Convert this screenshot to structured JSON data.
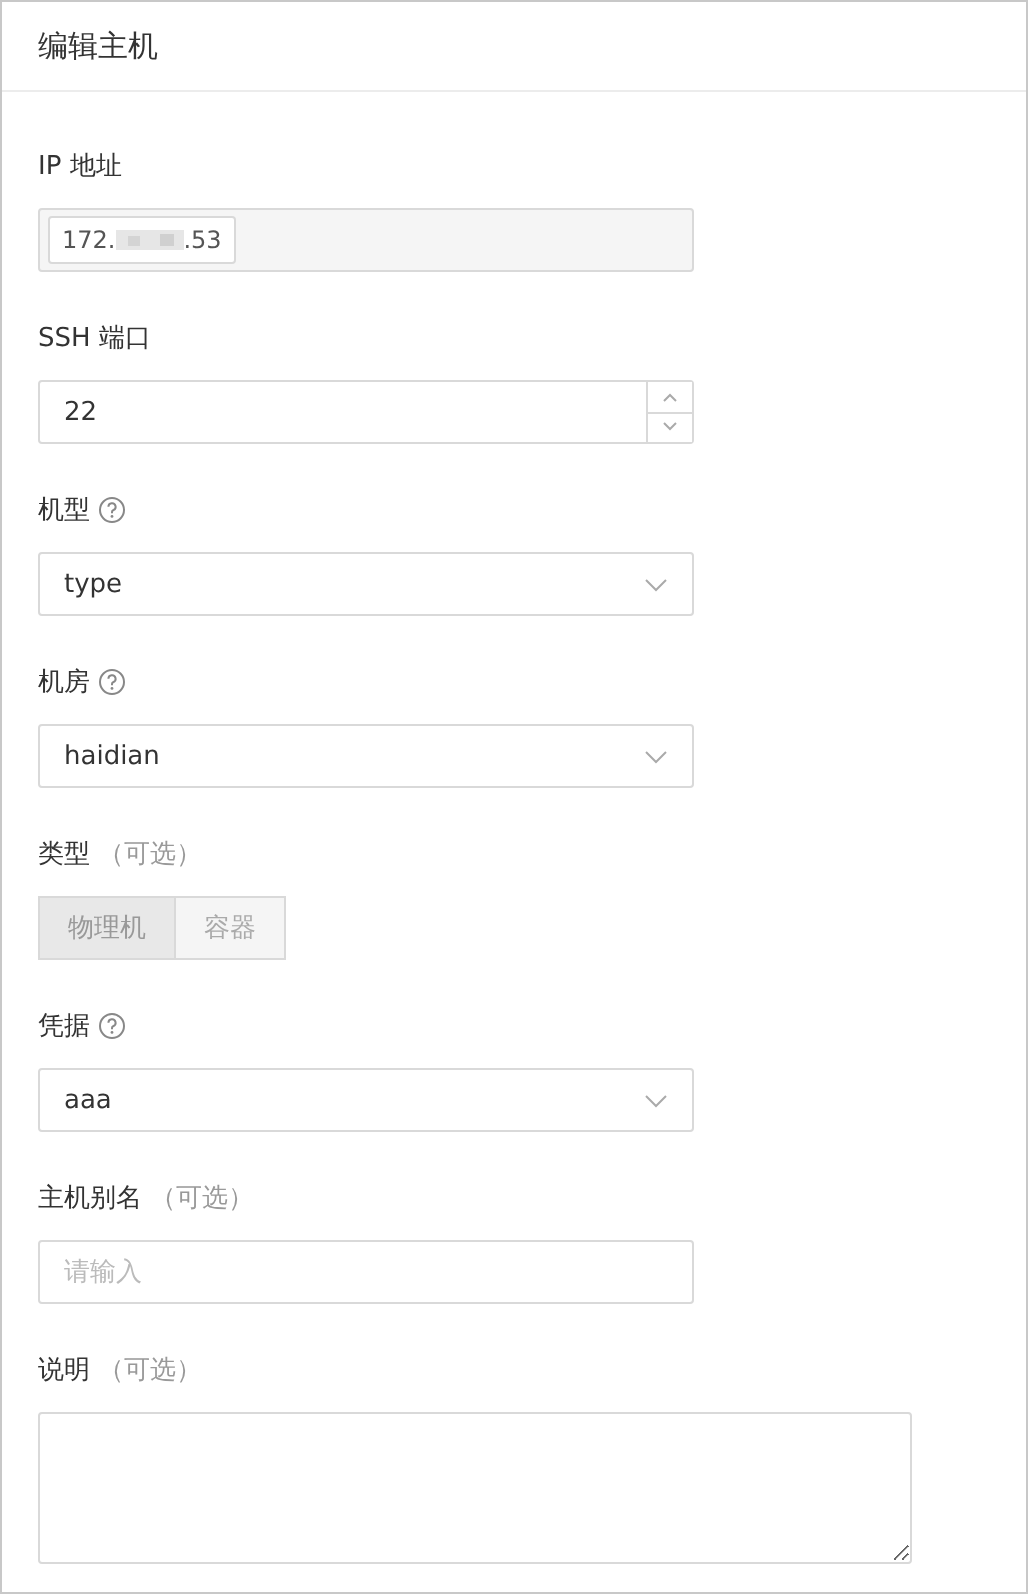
{
  "window": {
    "title": "编辑主机"
  },
  "fields": [
    {
      "kind": "tag",
      "label": "IP 地址",
      "help": false,
      "tag": {
        "prefix": "172.",
        "suffix": ".53"
      }
    },
    {
      "kind": "number",
      "label": "SSH 端口",
      "help": false,
      "value": "22"
    },
    {
      "kind": "select",
      "label": "机型",
      "help": true,
      "value": "type"
    },
    {
      "kind": "select",
      "label": "机房",
      "help": true,
      "value": "haidian"
    },
    {
      "kind": "segmented",
      "label": "类型",
      "help": false,
      "optional_text": "（可选）",
      "options": [
        {
          "label": "物理机",
          "selected": true
        },
        {
          "label": "容器",
          "selected": false
        }
      ]
    },
    {
      "kind": "select",
      "label": "凭据",
      "help": true,
      "value": "aaa"
    },
    {
      "kind": "text",
      "label": "主机别名",
      "help": false,
      "optional_text": "（可选）",
      "placeholder": "请输入"
    },
    {
      "kind": "textarea",
      "label": "说明",
      "help": false,
      "optional_text": "（可选）"
    }
  ]
}
